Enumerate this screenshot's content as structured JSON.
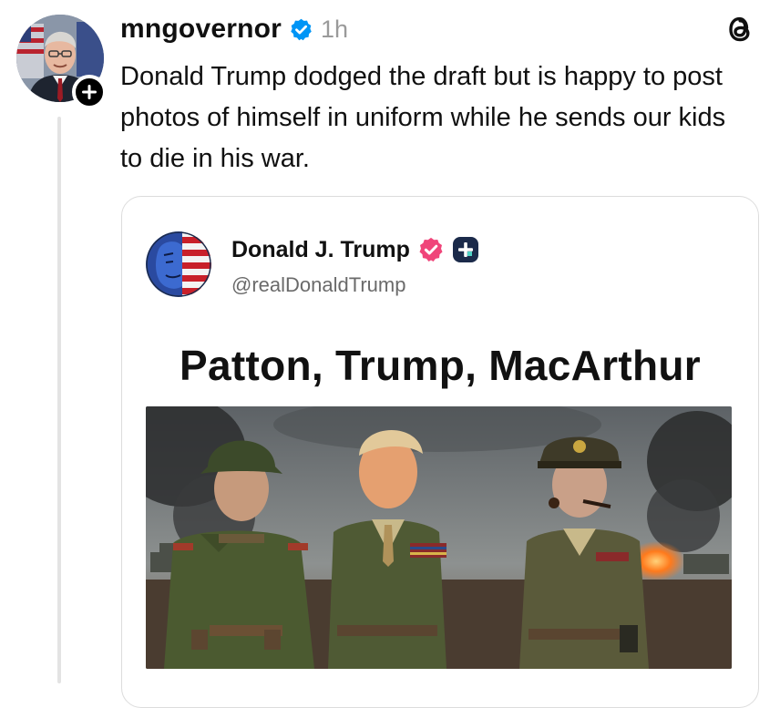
{
  "post": {
    "username": "mngovernor",
    "timestamp": "1h",
    "text": "Donald Trump dodged the draft but is happy to post photos of himself in uniform while he sends our kids to die in his war.",
    "icons": {
      "verified": "verified-badge-icon",
      "follow": "plus-icon",
      "app": "threads-logo-icon"
    },
    "colors": {
      "verified": "#0095f6",
      "line": "#e3e3e3",
      "muted": "#9a9a9a"
    }
  },
  "embed": {
    "name": "Donald J. Trump",
    "handle": "@realDonaldTrump",
    "meme_headline": "Patton, Trump, MacArthur",
    "colors": {
      "verified": "#f0457a",
      "plus_badge": "#1b2a4a"
    }
  }
}
